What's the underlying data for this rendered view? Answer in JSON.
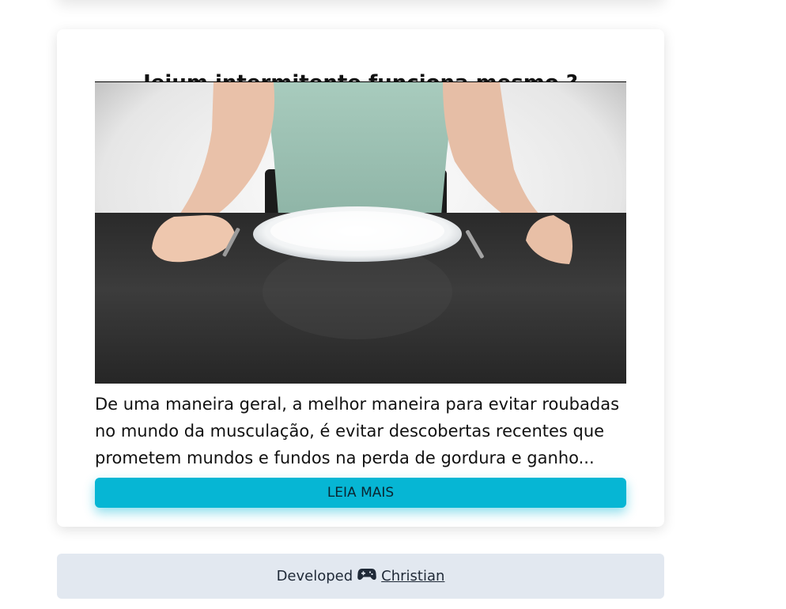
{
  "post": {
    "title": "Jejum intermitente funciona mesmo ?",
    "image_alt": "Mulher sentada diante de um prato vazio",
    "excerpt": "De uma maneira geral, a melhor maneira para evitar roubadas no mundo da musculação, é evitar descobertas recentes que prometem mundos e fundos na perda de gordura e ganho...",
    "read_more_label": "LEIA MAIS"
  },
  "footer": {
    "prefix": "Developed",
    "icon": "gamepad-icon",
    "author": "Christian"
  },
  "colors": {
    "accent": "#06b6d4",
    "footer_bg": "#e2e8f0"
  }
}
